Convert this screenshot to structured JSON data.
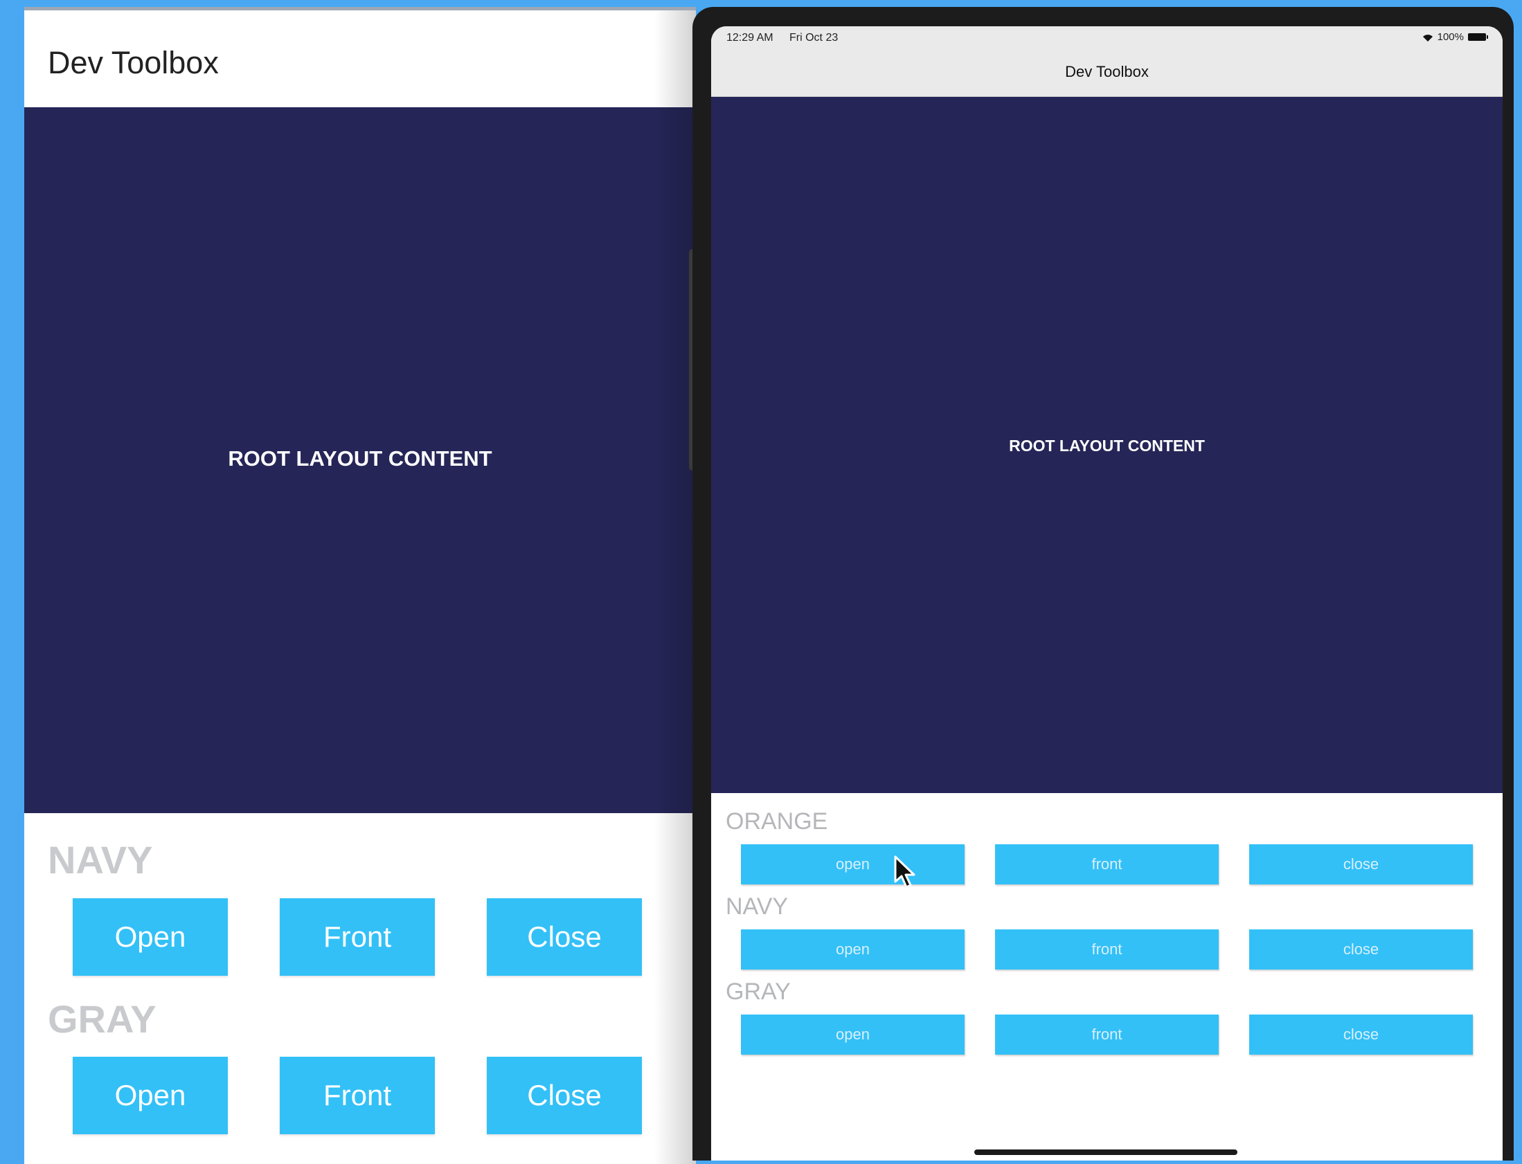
{
  "android": {
    "app_title": "Dev Toolbox",
    "content_label": "ROOT LAYOUT CONTENT",
    "sections": [
      {
        "title": "NAVY",
        "buttons": [
          "Open",
          "Front",
          "Close"
        ]
      },
      {
        "title": "GRAY",
        "buttons": [
          "Open",
          "Front",
          "Close"
        ]
      }
    ]
  },
  "ipad": {
    "status": {
      "time": "12:29 AM",
      "date": "Fri Oct 23",
      "battery": "100%"
    },
    "nav_title": "Dev Toolbox",
    "content_label": "ROOT LAYOUT CONTENT",
    "sections": [
      {
        "title": "ORANGE",
        "buttons": [
          "open",
          "front",
          "close"
        ]
      },
      {
        "title": "NAVY",
        "buttons": [
          "open",
          "front",
          "close"
        ]
      },
      {
        "title": "GRAY",
        "buttons": [
          "open",
          "front",
          "close"
        ]
      }
    ]
  },
  "colors": {
    "background": "#4aa8f3",
    "content_navy": "#252557",
    "button_blue": "#33c0f7",
    "section_gray": "#c9cacd"
  },
  "icons": [
    "wifi-icon",
    "battery-icon",
    "cursor-icon"
  ]
}
